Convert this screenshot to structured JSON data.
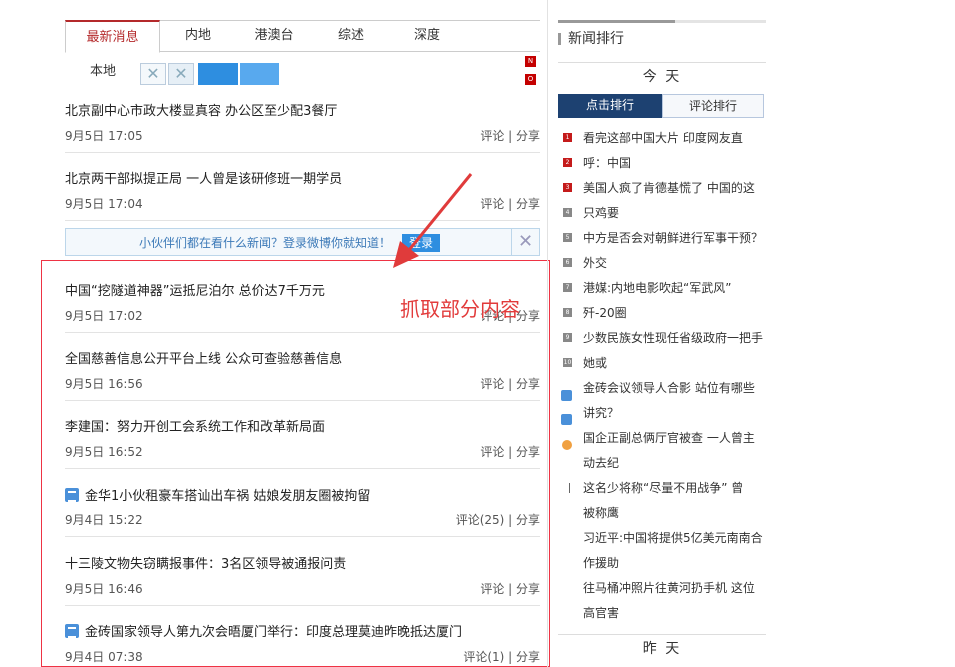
{
  "tabs": [
    "最新消息",
    "内地",
    "港澳台",
    "综述",
    "深度"
  ],
  "sub_tab": "本地",
  "badges": [
    "N",
    "O"
  ],
  "news": [
    {
      "title": "北京副中心市政大楼显真容 办公区至少配3餐厅",
      "time": "9月5日 17:05",
      "actions": "评论 | 分享",
      "icon": false
    },
    {
      "title": "北京两干部拟提正局 一人曾是该研修班一期学员",
      "time": "9月5日 17:04",
      "actions": "评论 | 分享",
      "icon": false
    },
    {
      "title": "中国“挖隧道神器”运抵尼泊尔 总价达7千万元",
      "time": "9月5日 17:02",
      "actions": "评论 | 分享",
      "icon": false
    },
    {
      "title": "全国慈善信息公开平台上线 公众可查验慈善信息",
      "time": "9月5日 16:56",
      "actions": "评论 | 分享",
      "icon": false
    },
    {
      "title": "李建国：努力开创工会系统工作和改革新局面",
      "time": "9月5日 16:52",
      "actions": "评论 | 分享",
      "icon": false
    },
    {
      "title": "金华1小伙租豪车搭讪出车祸 姑娘发朋友圈被拘留",
      "time": "9月4日 15:22",
      "actions": "评论(25) | 分享",
      "icon": true
    },
    {
      "title": "十三陵文物失窃瞒报事件：3名区领导被通报问责",
      "time": "9月5日 16:46",
      "actions": "评论 | 分享",
      "icon": false
    },
    {
      "title": "金砖国家领导人第九次会晤厦门举行：印度总理莫迪昨晚抵达厦门",
      "time": "9月4日 07:38",
      "actions": "评论(1) | 分享",
      "icon": true
    }
  ],
  "login_bar": {
    "text": "小伙伴们都在看什么新闻？登录微博你就知道！",
    "button": "登录",
    "close": "✕"
  },
  "annotation": "抓取部分内容",
  "ranking": {
    "title": "新闻排行",
    "today": "今 天",
    "yesterday": "昨 天",
    "tab_click": "点击排行",
    "tab_comment": "评论排行",
    "items": [
      "看完这部中国大片 印度网友直",
      "呼：中国",
      "美国人疯了肯德基慌了 中国的这",
      "只鸡要",
      "中方是否会对朝鲜进行军事干预？",
      "外交",
      "港媒:内地电影吹起“军武风”",
      "歼-20圈",
      "少数民族女性现任省级政府一把手",
      "她或",
      "金砖会议领导人合影 站位有哪些",
      "讲究？",
      "国企正副总俩厅官被查 一人曾主",
      "动去纪",
      "这名少将称“尽量不用战争” 曾",
      "被称鹰",
      "习近平:中国将提供5亿美元南南合",
      "作援助",
      "往马桶冲照片往黄河扔手机 这位",
      "高官害"
    ],
    "markers": [
      "1",
      "2",
      "3",
      "4",
      "5",
      "6",
      "7",
      "8",
      "9",
      "10"
    ]
  }
}
